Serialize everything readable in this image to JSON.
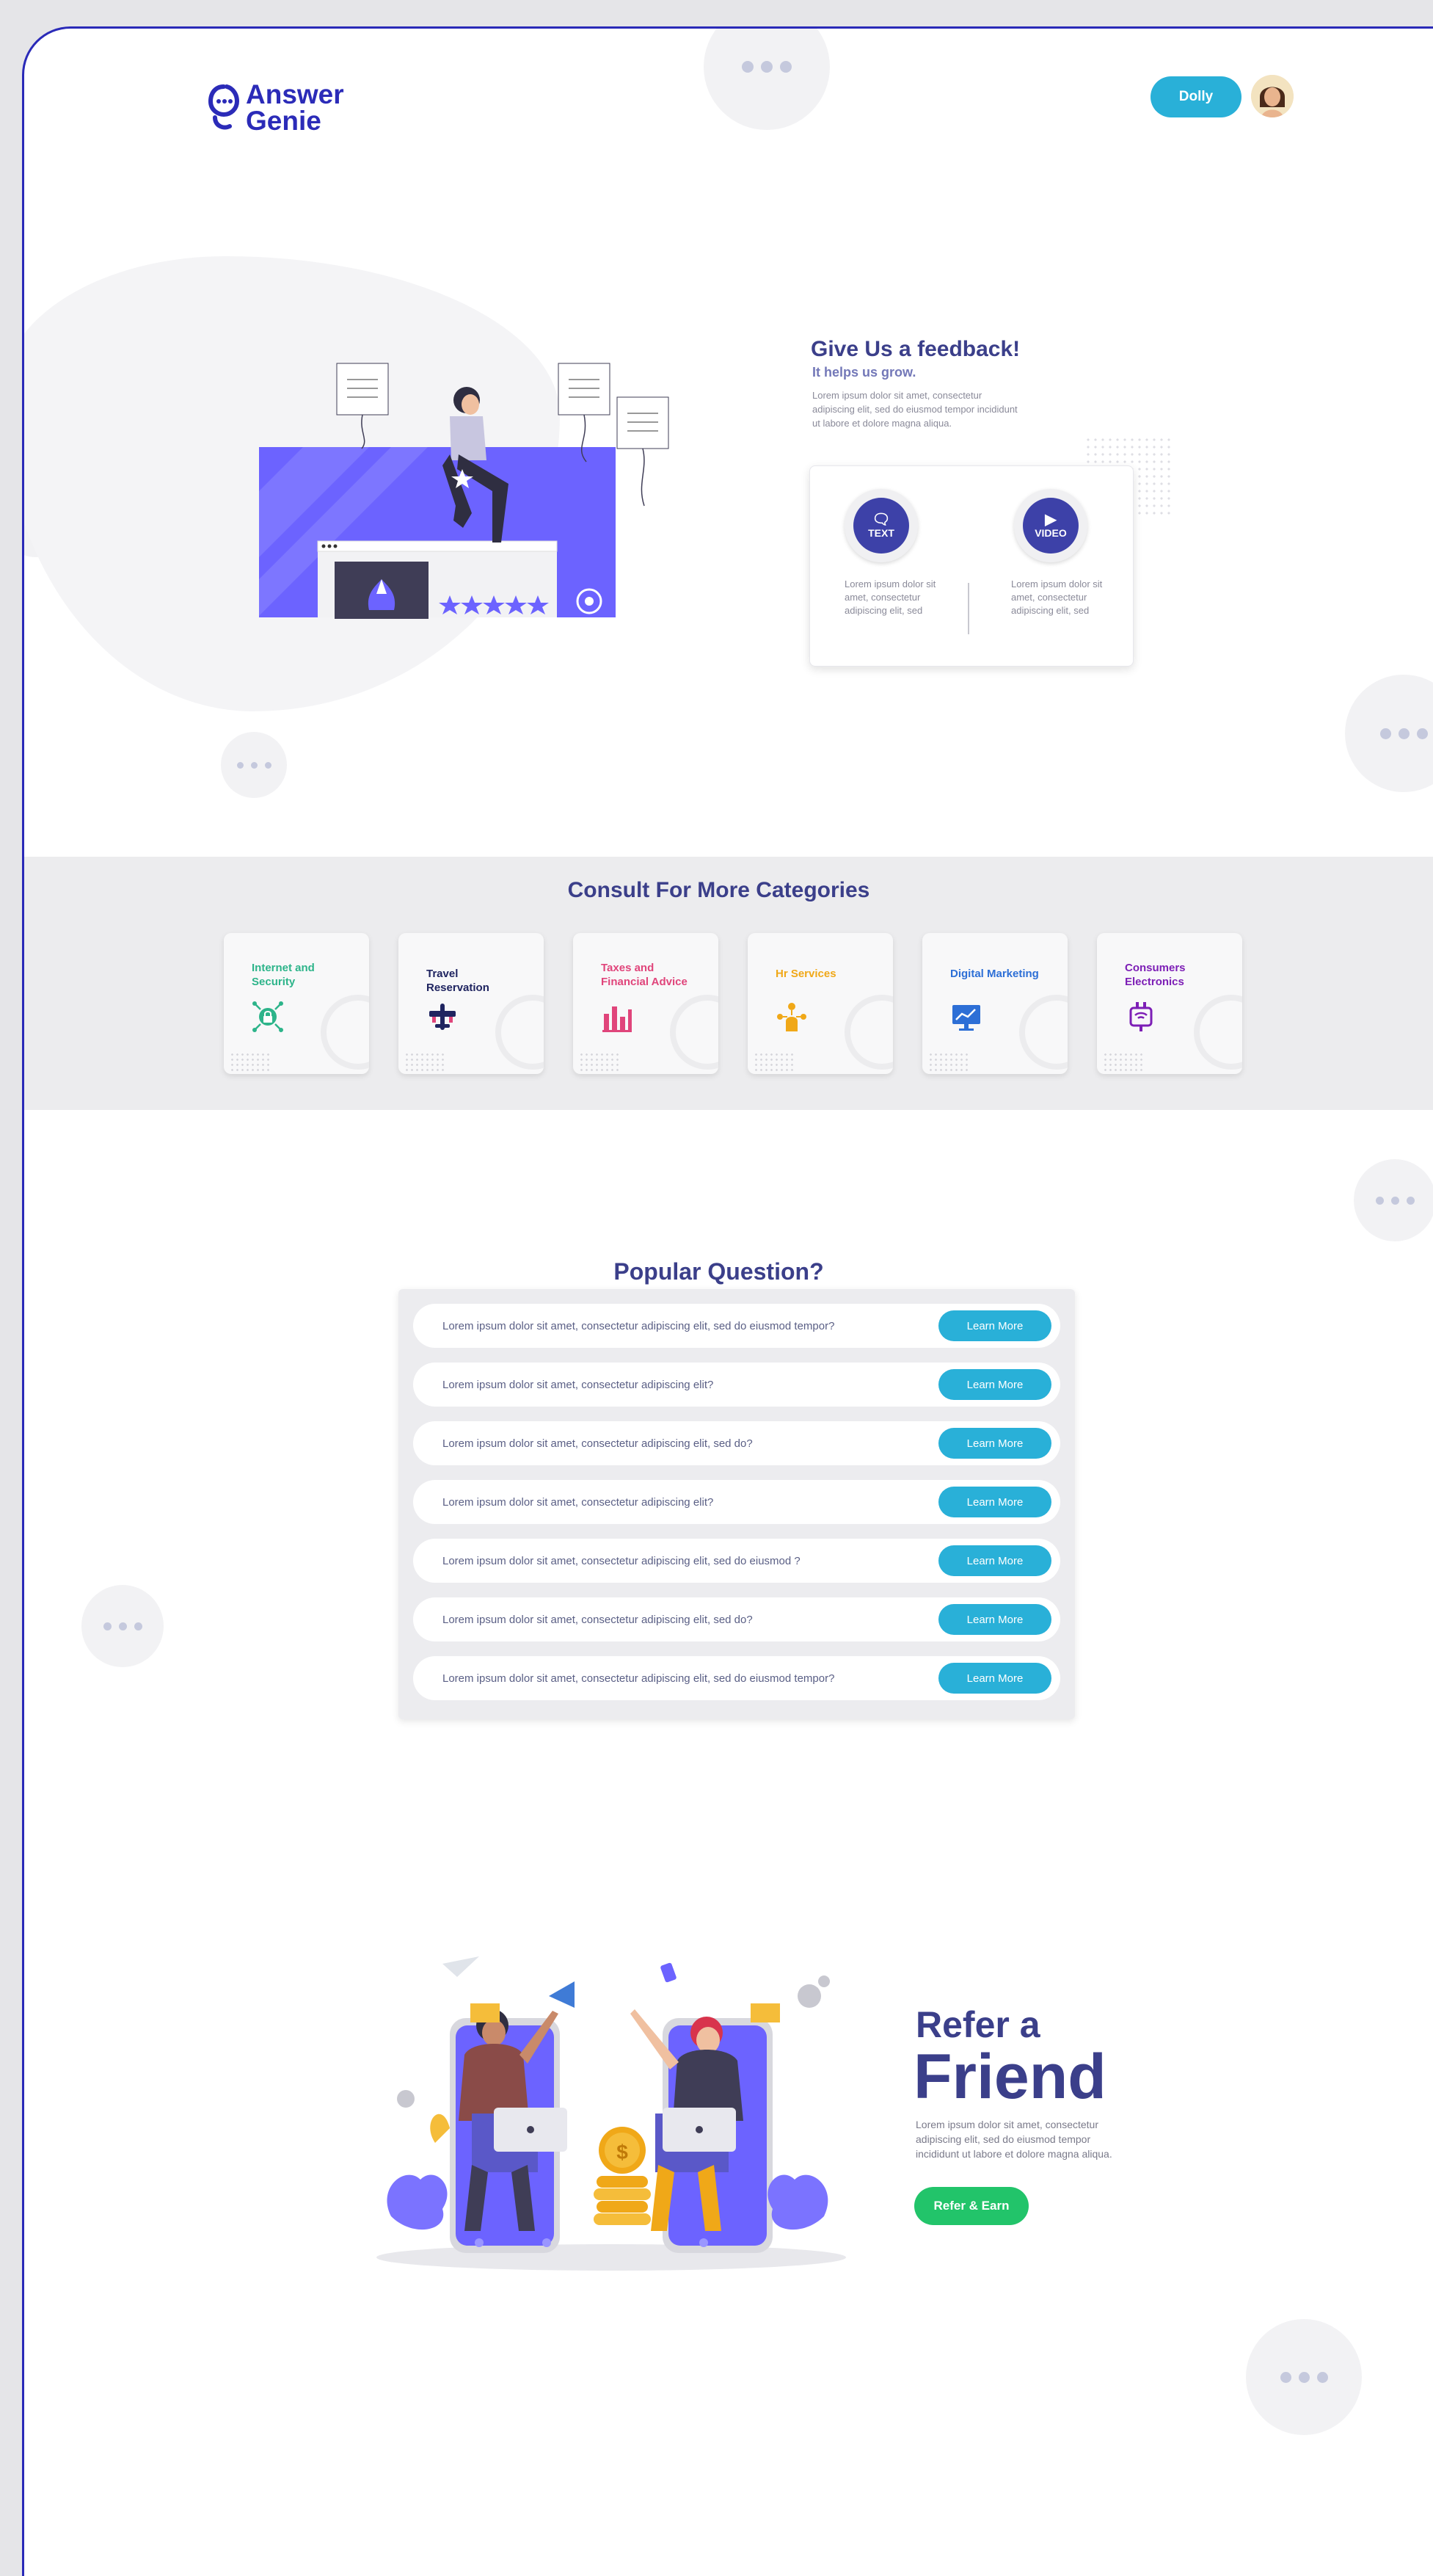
{
  "brand": {
    "logo_line1": "Answer",
    "logo_line2": "Genie",
    "color": "#2b2bb8"
  },
  "header": {
    "user_name": "Dolly"
  },
  "feedback": {
    "title": "Give Us a feedback!",
    "subtitle": "It helps us grow.",
    "text": "Lorem ipsum dolor sit amet, consectetur adipiscing elit, sed do eiusmod tempor incididunt ut labore et dolore magna aliqua.",
    "options": [
      {
        "label": "TEXT",
        "icon": "chat-icon",
        "desc": "Lorem ipsum dolor sit amet, consectetur adipiscing elit, sed"
      },
      {
        "label": "VIDEO",
        "icon": "video-camera-icon",
        "desc": "Lorem ipsum dolor sit amet, consectetur adipiscing elit, sed"
      }
    ]
  },
  "categories": {
    "title": "Consult For More Categories",
    "items": [
      {
        "label": "Internet and Security",
        "color": "#2db48a",
        "icon": "security-lock-icon"
      },
      {
        "label": "Travel Reservation",
        "color": "#1f2460",
        "icon": "airplane-icon"
      },
      {
        "label": "Taxes and Financial Advice",
        "color": "#e0457b",
        "icon": "finance-chart-icon"
      },
      {
        "label": "Hr Services",
        "color": "#f0a818",
        "icon": "people-network-icon"
      },
      {
        "label": "Digital Marketing",
        "color": "#2d6fd6",
        "icon": "monitor-chart-icon"
      },
      {
        "label": "Consumers Electronics",
        "color": "#7d1fb6",
        "icon": "electronic-plug-icon"
      }
    ]
  },
  "questions": {
    "title": "Popular Question?",
    "button_label": "Learn More",
    "items": [
      "Lorem ipsum dolor sit amet, consectetur adipiscing elit, sed do eiusmod tempor?",
      "Lorem ipsum dolor sit amet, consectetur adipiscing elit?",
      "Lorem ipsum dolor sit amet, consectetur adipiscing elit, sed do?",
      "Lorem ipsum dolor sit amet, consectetur adipiscing elit?",
      "Lorem ipsum dolor sit amet, consectetur adipiscing elit, sed do eiusmod ?",
      "Lorem ipsum dolor sit amet, consectetur adipiscing elit, sed do?",
      "Lorem ipsum dolor sit amet, consectetur adipiscing elit, sed do eiusmod tempor?"
    ]
  },
  "refer": {
    "title_line1": "Refer a",
    "title_line2": "Friend",
    "text": "Lorem ipsum dolor sit amet, consectetur adipiscing elit, sed do eiusmod tempor incididunt ut labore et dolore magna aliqua.",
    "button_label": "Refer & Earn"
  },
  "colors": {
    "accent": "#29b0d8",
    "primary": "#3b3f8a",
    "green": "#22c46a",
    "purple": "#6c63ff"
  }
}
